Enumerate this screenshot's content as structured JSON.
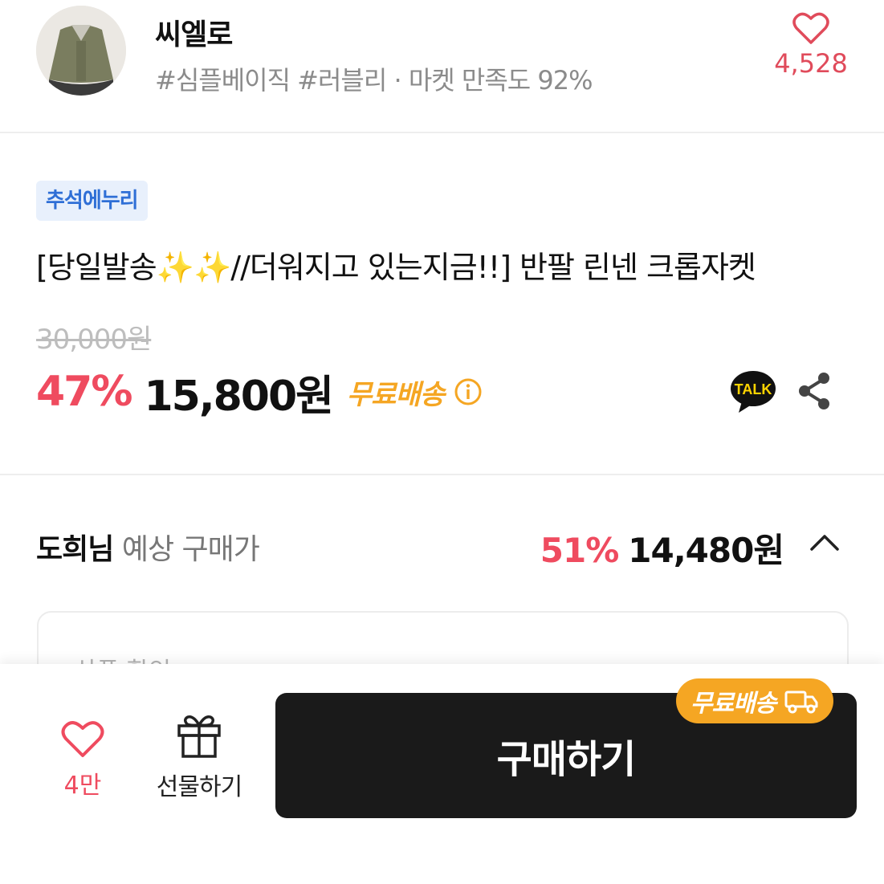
{
  "store": {
    "name": "씨엘로",
    "tags": "#심플베이직 #러블리 · 마켓 만족도 92%",
    "like_count": "4,528"
  },
  "product": {
    "badge": "추석에누리",
    "title": "[당일발송✨✨//더워지고 있는지금!!]  반팔 린넨 크롭자켓",
    "original_price": "30,000원",
    "discount_rate": "47%",
    "sale_price": "15,800원",
    "shipping_label": "무료배송"
  },
  "expected": {
    "name": "도희님",
    "label": "예상 구매가",
    "discount_rate": "51%",
    "price": "14,480원",
    "card_label": "상품 할인"
  },
  "bottom_bar": {
    "wish_count": "4만",
    "gift_label": "선물하기",
    "buy_label": "구매하기",
    "shipping_pill": "무료배송"
  },
  "colors": {
    "accent_red": "#ef4b5f",
    "shipping_orange": "#f5a623",
    "badge_blue": "#2f6fd6",
    "button_dark": "#1a1a1a"
  },
  "icons": [
    "heart-icon",
    "info-icon",
    "kakao-talk-icon",
    "share-icon",
    "chevron-up-icon",
    "gift-icon",
    "truck-icon"
  ]
}
